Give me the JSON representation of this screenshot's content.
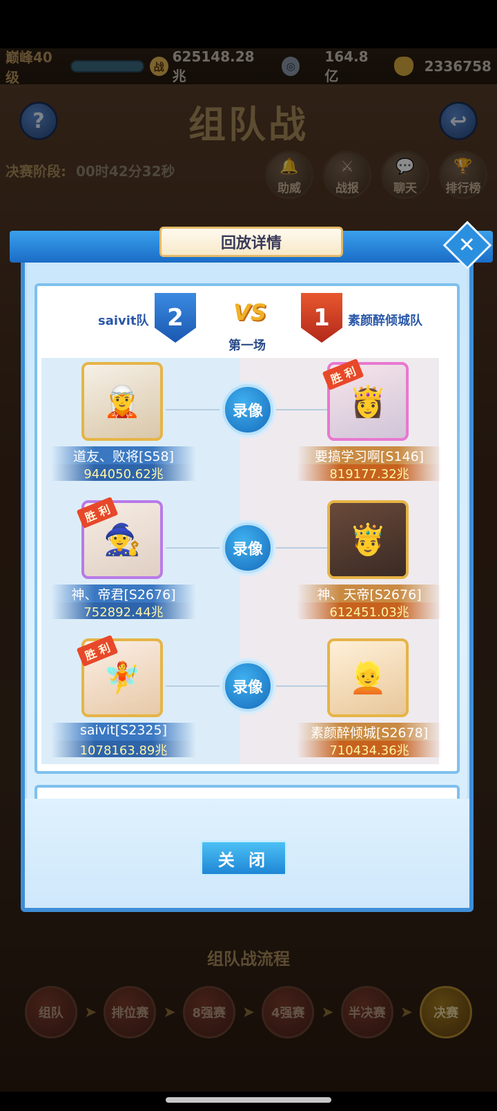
{
  "status": {
    "level": "巅峰40级",
    "power_value": "625148.28兆",
    "silver_value": "164.8亿",
    "gold_value": "2336758",
    "power_icon": "battle-power-icon",
    "silver_icon": "coin-icon",
    "gold_icon": "ingot-icon"
  },
  "header": {
    "title": "组队战",
    "help_label": "?",
    "back_label": "↩",
    "phase_label": "决赛阶段:",
    "phase_timer": "00时42分32秒",
    "side_buttons": [
      "助威",
      "战报",
      "聊天",
      "排行榜"
    ]
  },
  "flow": {
    "title": "组队战流程",
    "steps": [
      "组队",
      "排位赛",
      "8强赛",
      "4强赛",
      "半决赛",
      "决赛"
    ],
    "active_step": "决赛"
  },
  "modal": {
    "title": "回放详情",
    "close_label": "关 闭",
    "match": {
      "label": "第一场",
      "vs": "VS",
      "left_team": "saivit队",
      "left_score": "2",
      "right_team": "素颜醉倾城队",
      "right_score": "1",
      "replay_label": "录像",
      "win_label": "胜 利",
      "duels": [
        {
          "left": {
            "name": "道友、败将[S58]",
            "power": "944050.62兆",
            "win": false
          },
          "right": {
            "name": "要搞学习啊[S146]",
            "power": "819177.32兆",
            "win": true
          }
        },
        {
          "left": {
            "name": "神、帝君[S2676]",
            "power": "752892.44兆",
            "win": true
          },
          "right": {
            "name": "神、天帝[S2676]",
            "power": "612451.03兆",
            "win": false
          }
        },
        {
          "left": {
            "name": "saivit[S2325]",
            "power": "1078163.89兆",
            "win": true
          },
          "right": {
            "name": "素颜醉倾城[S2678]",
            "power": "710434.36兆",
            "win": false
          }
        }
      ]
    }
  },
  "colors": {
    "modal_border": "#3e8ed6",
    "blue_team": "#2a58a8",
    "red_team": "#b2281a",
    "win_badge": "#e8482a",
    "power_text": "#fff4a8"
  }
}
